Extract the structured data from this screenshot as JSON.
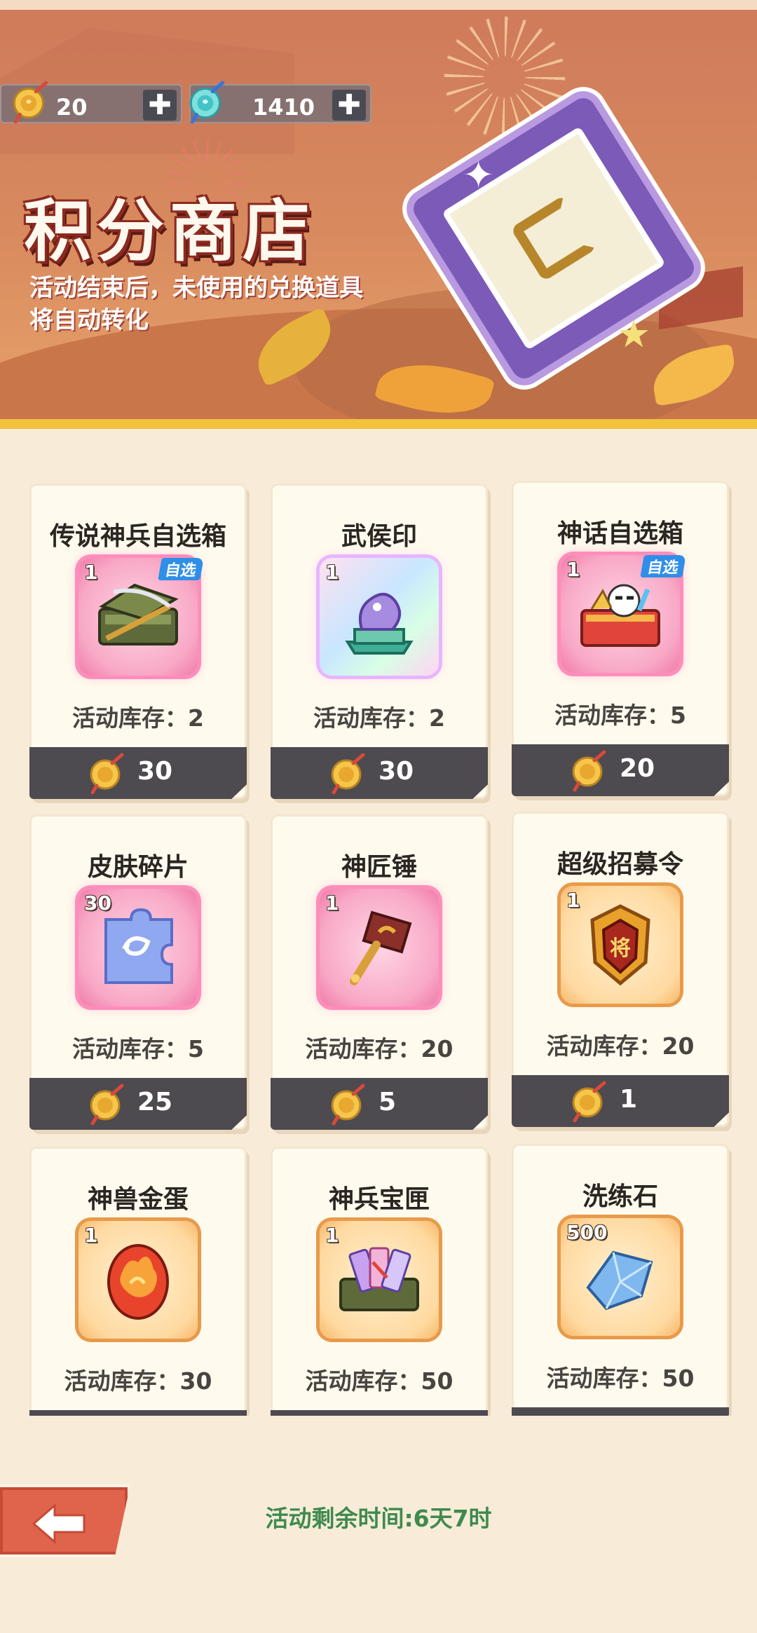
{
  "header": {
    "title": "积分商店",
    "description": "活动结束后，未使用的兑换道具将自动转化",
    "currencies": [
      {
        "icon": "gold-token-icon",
        "value": "20",
        "add_label": "✚"
      },
      {
        "icon": "blue-token-icon",
        "value": "1410",
        "add_label": "✚"
      }
    ]
  },
  "items": [
    {
      "name": "传说神兵自选箱",
      "qty": "1",
      "tag": "自选",
      "stock": "活动库存：2",
      "price": "30",
      "icon": "legendary-weapon-chest-icon",
      "style": "pink"
    },
    {
      "name": "武侯印",
      "qty": "1",
      "tag": "",
      "stock": "活动库存：2",
      "price": "30",
      "icon": "jade-seal-icon",
      "style": "holo"
    },
    {
      "name": "神话自选箱",
      "qty": "1",
      "tag": "自选",
      "stock": "活动库存：5",
      "price": "20",
      "icon": "mythic-chest-icon",
      "style": "pink"
    },
    {
      "name": "皮肤碎片",
      "qty": "30",
      "tag": "",
      "stock": "活动库存：5",
      "price": "25",
      "icon": "skin-fragment-icon",
      "style": "pink"
    },
    {
      "name": "神匠锤",
      "qty": "1",
      "tag": "",
      "stock": "活动库存：20",
      "price": "5",
      "icon": "smith-hammer-icon",
      "style": "pink"
    },
    {
      "name": "超级招募令",
      "qty": "1",
      "tag": "",
      "stock": "活动库存：20",
      "price": "1",
      "icon": "recruit-badge-icon",
      "style": "gold"
    },
    {
      "name": "神兽金蛋",
      "qty": "1",
      "tag": "",
      "stock": "活动库存：30",
      "price": "",
      "icon": "golden-egg-icon",
      "style": "gold"
    },
    {
      "name": "神兵宝匣",
      "qty": "1",
      "tag": "",
      "stock": "活动库存：50",
      "price": "",
      "icon": "weapon-case-icon",
      "style": "gold"
    },
    {
      "name": "洗练石",
      "qty": "500",
      "tag": "",
      "stock": "活动库存：50",
      "price": "",
      "icon": "refining-stone-icon",
      "style": "gold"
    }
  ],
  "footer": {
    "back_icon": "back-arrow-icon",
    "timer": "活动剩余时间:6天7时"
  },
  "colors": {
    "banner": "#d88a5e",
    "background": "#f8ecd9",
    "price_bar": "#4d4a50",
    "timer_text": "#3f8a4f",
    "back_button": "#e0644c"
  }
}
